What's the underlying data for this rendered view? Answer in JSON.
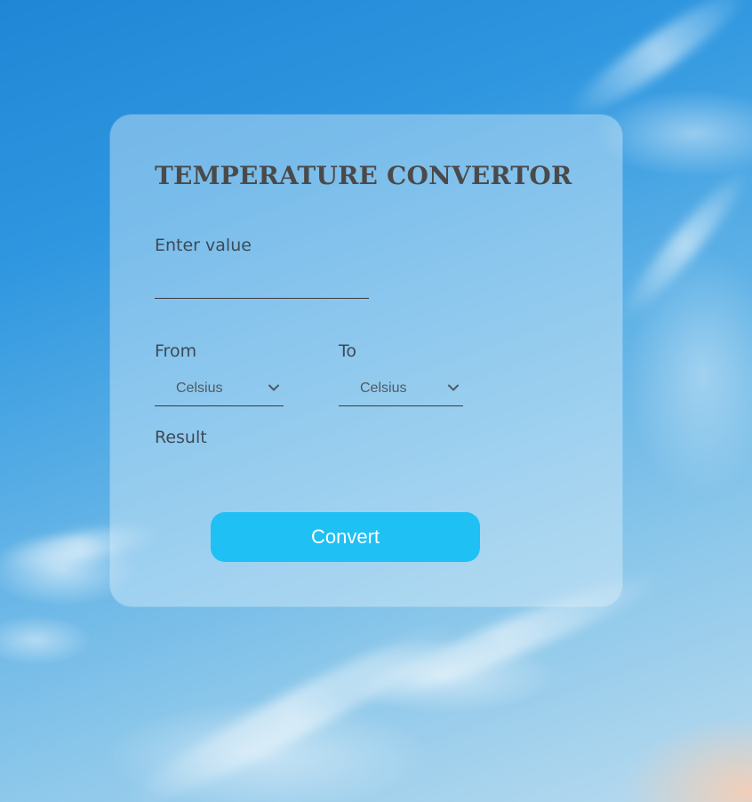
{
  "app": {
    "title": "TEMPERATURE CONVERTOR"
  },
  "form": {
    "value_label": "Enter value",
    "value_input": "",
    "from_label": "From",
    "from_selected": "Celsius",
    "to_label": "To",
    "to_selected": "Celsius",
    "result_label": "Result",
    "result_value": "",
    "convert_label": "Convert"
  },
  "icons": {
    "from_chevron": "chevron-down-icon",
    "to_chevron": "chevron-down-icon"
  },
  "colors": {
    "title": "#4a4a4a",
    "button": "#1fc0f4",
    "button_text": "#ffffff",
    "label": "#3c4a55"
  }
}
